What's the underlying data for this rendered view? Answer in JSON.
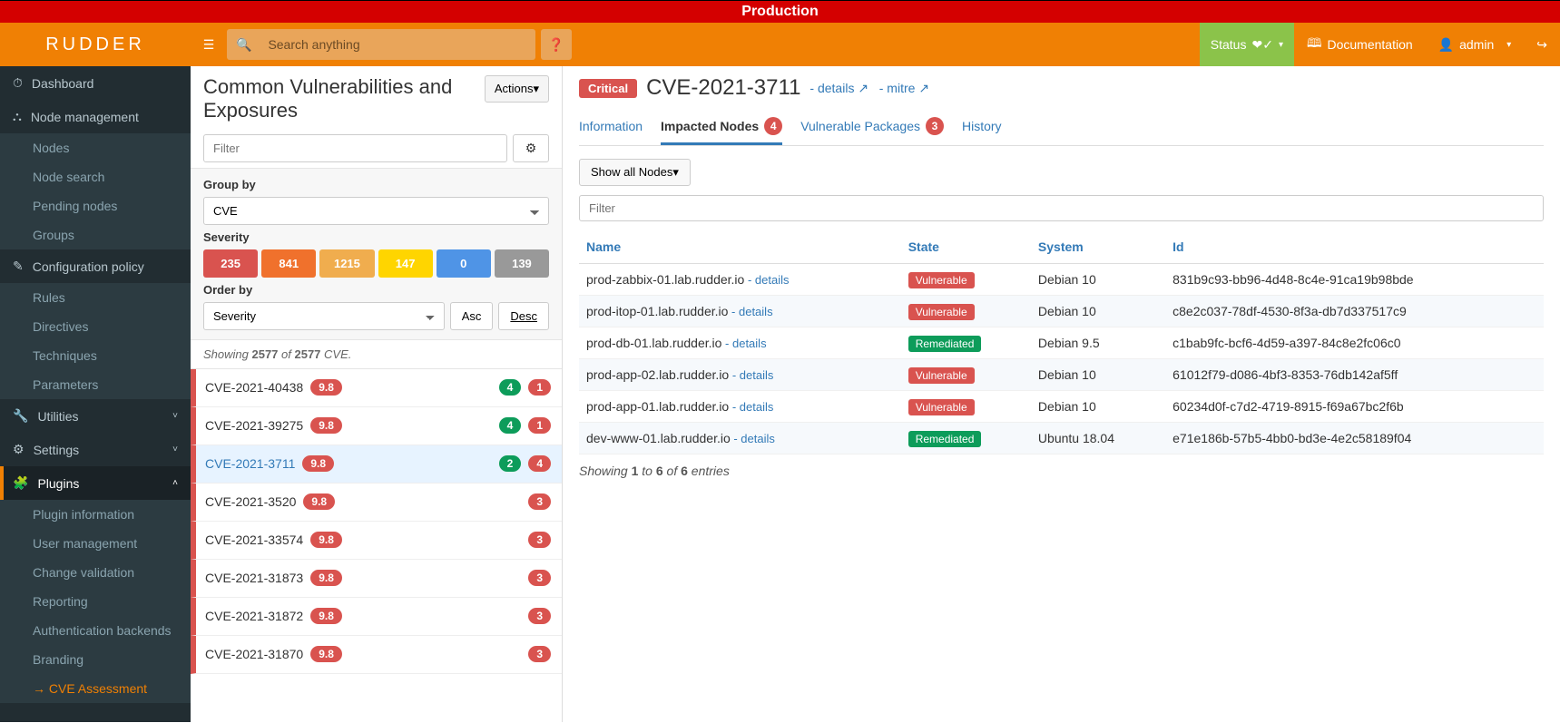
{
  "env_banner": "Production",
  "brand": "RUDDER",
  "topbar": {
    "search_placeholder": "Search anything",
    "status_label": "Status",
    "doc_label": "Documentation",
    "user_label": "admin"
  },
  "sidebar": {
    "items": [
      {
        "icon": "dashboard-icon",
        "label": "Dashboard"
      },
      {
        "icon": "sitemap-icon",
        "label": "Node management",
        "children": [
          "Nodes",
          "Node search",
          "Pending nodes",
          "Groups"
        ]
      },
      {
        "icon": "pencil-icon",
        "label": "Configuration policy",
        "children": [
          "Rules",
          "Directives",
          "Techniques",
          "Parameters"
        ]
      },
      {
        "icon": "wrench-icon",
        "label": "Utilities",
        "collapsible": true
      },
      {
        "icon": "gear-icon",
        "label": "Settings",
        "collapsible": true
      },
      {
        "icon": "puzzle-icon",
        "label": "Plugins",
        "expanded": true,
        "children": [
          "Plugin information",
          "User management",
          "Change validation",
          "Reporting",
          "Authentication backends",
          "Branding",
          "CVE Assessment"
        ]
      }
    ],
    "active_child": "CVE Assessment"
  },
  "middle": {
    "title": "Common Vulnerabilities and Exposures",
    "actions_label": "Actions",
    "filter_placeholder": "Filter",
    "group_by_label": "Group by",
    "group_by_value": "CVE",
    "severity_label": "Severity",
    "severity_counts": [
      {
        "value": "235",
        "color": "#d9534f"
      },
      {
        "value": "841",
        "color": "#f0712c"
      },
      {
        "value": "1215",
        "color": "#f0ad4e"
      },
      {
        "value": "147",
        "color": "#ffd500"
      },
      {
        "value": "0",
        "color": "#4f94e6"
      },
      {
        "value": "139",
        "color": "#999"
      }
    ],
    "order_by_label": "Order by",
    "order_by_value": "Severity",
    "asc_label": "Asc",
    "desc_label": "Desc",
    "showing_prefix": "Showing ",
    "showing_n1": "2577",
    "showing_mid": " of ",
    "showing_n2": "2577",
    "showing_suffix": " CVE.",
    "cves": [
      {
        "id": "CVE-2021-40438",
        "score": "9.8",
        "green": "4",
        "red": "1"
      },
      {
        "id": "CVE-2021-39275",
        "score": "9.8",
        "green": "4",
        "red": "1"
      },
      {
        "id": "CVE-2021-3711",
        "score": "9.8",
        "green": "2",
        "red": "4",
        "selected": true
      },
      {
        "id": "CVE-2021-3520",
        "score": "9.8",
        "red": "3"
      },
      {
        "id": "CVE-2021-33574",
        "score": "9.8",
        "red": "3"
      },
      {
        "id": "CVE-2021-31873",
        "score": "9.8",
        "red": "3"
      },
      {
        "id": "CVE-2021-31872",
        "score": "9.8",
        "red": "3"
      },
      {
        "id": "CVE-2021-31870",
        "score": "9.8",
        "red": "3"
      }
    ]
  },
  "detail": {
    "severity_badge": "Critical",
    "title": "CVE-2021-3711",
    "dash_details": "- details",
    "dash_mitre": "- mitre",
    "tabs": {
      "information": "Information",
      "impacted": "Impacted Nodes",
      "impacted_count": "4",
      "packages": "Vulnerable Packages",
      "packages_count": "3",
      "history": "History"
    },
    "show_nodes_label": "Show all Nodes",
    "filter_placeholder": "Filter",
    "columns": {
      "name": "Name",
      "state": "State",
      "system": "System",
      "id": "Id"
    },
    "row_details_label": "details",
    "rows": [
      {
        "name": "prod-zabbix-01.lab.rudder.io",
        "state": "Vulnerable",
        "system": "Debian 10",
        "id": "831b9c93-bb96-4d48-8c4e-91ca19b98bde"
      },
      {
        "name": "prod-itop-01.lab.rudder.io",
        "state": "Vulnerable",
        "system": "Debian 10",
        "id": "c8e2c037-78df-4530-8f3a-db7d337517c9"
      },
      {
        "name": "prod-db-01.lab.rudder.io",
        "state": "Remediated",
        "system": "Debian 9.5",
        "id": "c1bab9fc-bcf6-4d59-a397-84c8e2fc06c0"
      },
      {
        "name": "prod-app-02.lab.rudder.io",
        "state": "Vulnerable",
        "system": "Debian 10",
        "id": "61012f79-d086-4bf3-8353-76db142af5ff"
      },
      {
        "name": "prod-app-01.lab.rudder.io",
        "state": "Vulnerable",
        "system": "Debian 10",
        "id": "60234d0f-c7d2-4719-8915-f69a67bc2f6b"
      },
      {
        "name": "dev-www-01.lab.rudder.io",
        "state": "Remediated",
        "system": "Ubuntu 18.04",
        "id": "e71e186b-57b5-4bb0-bd3e-4e2c58189f04"
      }
    ],
    "footer": {
      "prefix": "Showing ",
      "from": "1",
      "to_word": " to ",
      "to": "6",
      "of_word": " of ",
      "total": "6",
      "suffix": " entries"
    }
  }
}
